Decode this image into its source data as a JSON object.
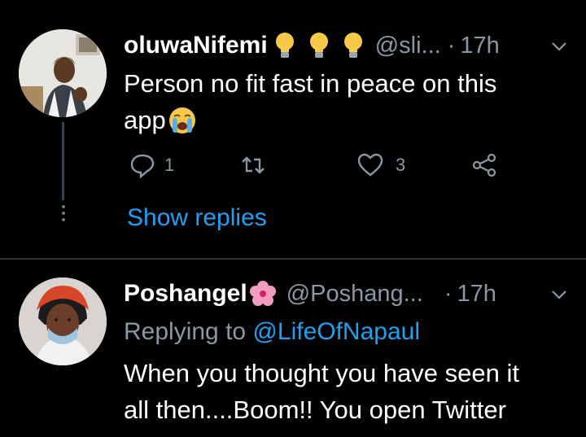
{
  "tweet1": {
    "display_name": "oluwaNifemi",
    "name_emojis": [
      "lightbulb-emoji",
      "lightbulb-emoji",
      "lightbulb-emoji"
    ],
    "handle": "@sli...",
    "separator": "·",
    "time": "17h",
    "text_line1": "Person no fit fast in peace on this",
    "text_line2": "app",
    "text_emoji": "loudly-crying-face-emoji",
    "reply_count": "1",
    "retweet_count": "",
    "like_count": "3",
    "show_replies_label": "Show replies"
  },
  "tweet2": {
    "display_name": "Poshangel",
    "name_emoji": "hibiscus-flower-emoji",
    "handle": "@Poshang...",
    "separator": "·",
    "time": "17h",
    "replying_prefix": "Replying to",
    "replying_handle": "@LifeOfNapaul",
    "text_line1": "When you thought you have seen it",
    "text_line2": "all then....Boom!! You open Twitter"
  },
  "colors": {
    "background": "#000000",
    "text": "#ffffff",
    "muted": "#8899a6",
    "link": "#1da1f2",
    "divider": "#2f3336"
  },
  "icons": [
    "reply-icon",
    "retweet-icon",
    "like-icon",
    "share-icon",
    "chevron-down-icon"
  ]
}
